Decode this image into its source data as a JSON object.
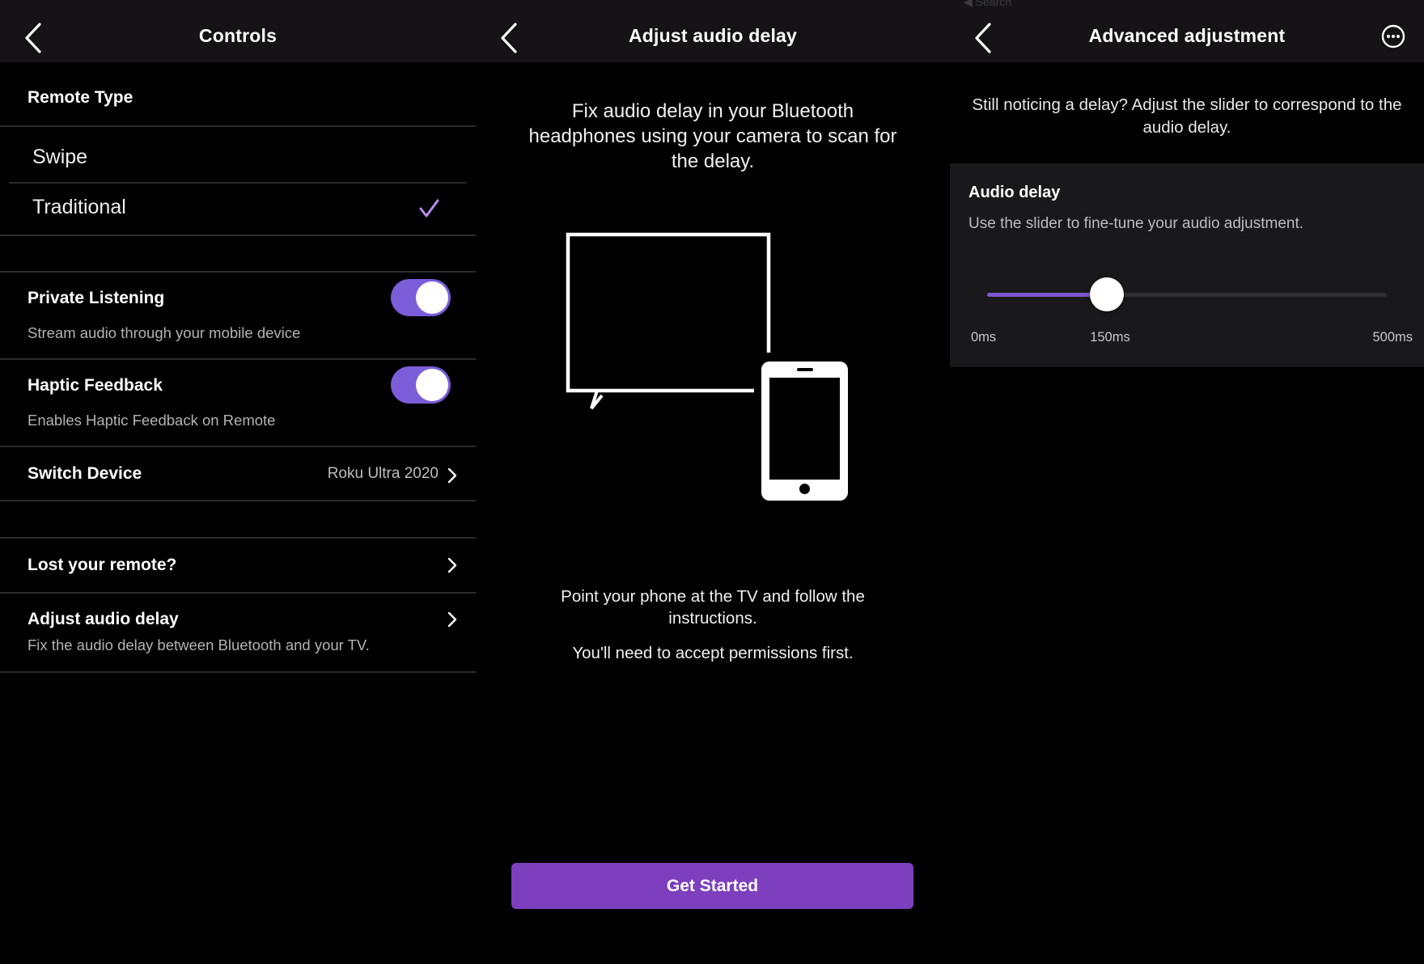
{
  "panels": {
    "controls": {
      "title": "Controls",
      "remote_type": {
        "heading": "Remote Type",
        "options": [
          {
            "label": "Swipe",
            "selected": false
          },
          {
            "label": "Traditional",
            "selected": true
          }
        ]
      },
      "private_listening": {
        "title": "Private Listening",
        "subtitle": "Stream audio through your mobile device",
        "enabled": true
      },
      "haptic_feedback": {
        "title": "Haptic Feedback",
        "subtitle": "Enables Haptic Feedback on Remote",
        "enabled": true
      },
      "switch_device": {
        "title": "Switch Device",
        "value": "Roku Ultra 2020"
      },
      "lost_remote": {
        "title": "Lost your remote?"
      },
      "adjust_audio_delay": {
        "title": "Adjust audio delay",
        "subtitle": "Fix the audio delay between Bluetooth and your TV."
      }
    },
    "audio_delay": {
      "title": "Adjust audio delay",
      "intro": "Fix audio delay in your Bluetooth headphones using your camera to scan for the delay.",
      "instruction": "Point your phone at the TV and follow the instructions.",
      "permissions": "You'll need to accept permissions first.",
      "cta": "Get Started"
    },
    "advanced": {
      "status_text": "◀ Search",
      "title": "Advanced adjustment",
      "notice": "Still noticing a delay? Adjust the slider to correspond to the audio delay.",
      "card": {
        "title": "Audio delay",
        "subtitle": "Use the slider to fine-tune your audio adjustment.",
        "slider": {
          "min": 0,
          "max": 500,
          "value": 150,
          "unit": "ms"
        },
        "labels": {
          "min": "0ms",
          "value": "150ms",
          "max": "500ms"
        }
      }
    }
  },
  "colors": {
    "accent": "#7b5cd9",
    "button": "#7d3fbd",
    "checkmark": "#b88cf2",
    "topbar": "#151316",
    "background": "#000000"
  },
  "icons": [
    "back-arrow-icon",
    "checkmark-icon",
    "chevron-right-icon",
    "more-options-icon",
    "tv-icon",
    "phone-icon"
  ]
}
